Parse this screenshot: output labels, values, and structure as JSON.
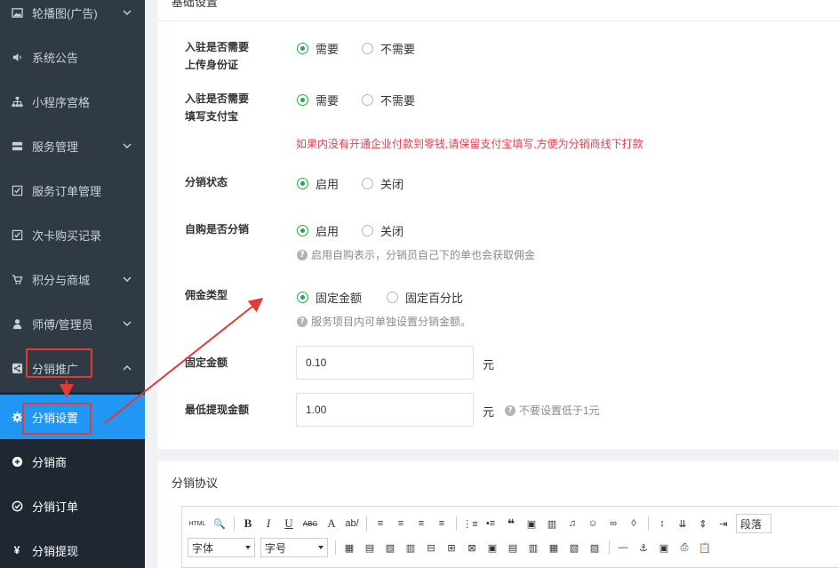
{
  "sidebar": {
    "items": [
      {
        "label": "轮播图(广告)",
        "icon": "image-icon",
        "chevron": true
      },
      {
        "label": "系统公告",
        "icon": "volume-icon",
        "chevron": false
      },
      {
        "label": "小程序宫格",
        "icon": "sitemap-icon",
        "chevron": false
      },
      {
        "label": "服务管理",
        "icon": "server-icon",
        "chevron": true
      },
      {
        "label": "服务订单管理",
        "icon": "check-square-icon",
        "chevron": false
      },
      {
        "label": "次卡购买记录",
        "icon": "check-square-icon",
        "chevron": false
      },
      {
        "label": "积分与商城",
        "icon": "cart-icon",
        "chevron": true
      },
      {
        "label": "师傅/管理员",
        "icon": "user-icon",
        "chevron": true
      },
      {
        "label": "分销推广",
        "icon": "share-icon",
        "chevron": true
      }
    ],
    "submenu": [
      {
        "label": "分销设置",
        "icon": "gear-icon",
        "active": true
      },
      {
        "label": "分销商",
        "icon": "plus-circle-icon",
        "active": false
      },
      {
        "label": "分销订单",
        "icon": "check-circle-icon",
        "active": false
      },
      {
        "label": "分销提现",
        "icon": "yen-icon",
        "active": false
      }
    ]
  },
  "panel": {
    "title": "基础设置",
    "rows": {
      "id_card": {
        "label_line1": "入驻是否需要",
        "label_line2": "上传身份证",
        "opt1": "需要",
        "opt2": "不需要"
      },
      "alipay": {
        "label_line1": "入驻是否需要",
        "label_line2": "填写支付宝",
        "opt1": "需要",
        "opt2": "不需要",
        "warning": "如果内没有开通企业付款到零钱,请保留支付宝填写,方便为分销商线下打款"
      },
      "status": {
        "label": "分销状态",
        "opt1": "启用",
        "opt2": "关闭"
      },
      "self_buy": {
        "label": "自购是否分销",
        "opt1": "启用",
        "opt2": "关闭",
        "hint": "启用自购表示，分销员自己下的单也会获取佣金"
      },
      "commission": {
        "label": "佣金类型",
        "opt1": "固定金额",
        "opt2": "固定百分比",
        "hint": "服务项目内可单独设置分销金额。"
      },
      "fixed_amount": {
        "label": "固定金额",
        "value": "0.10",
        "unit": "元"
      },
      "min_withdraw": {
        "label": "最低提现金额",
        "value": "1.00",
        "unit": "元",
        "hint": "不要设置低于1元"
      }
    }
  },
  "agreement": {
    "title": "分销协议",
    "toolbar": {
      "html_label": "HTML",
      "bold": "B",
      "italic": "I",
      "underline": "U",
      "strike": "ABC",
      "font_color": "A",
      "paragraph": "段落",
      "font_family": "字体",
      "font_size": "字号"
    }
  },
  "colors": {
    "accent": "#2196f3",
    "radio_on": "#2ea44f",
    "warning": "#e2404f",
    "highlight": "#e53935"
  }
}
